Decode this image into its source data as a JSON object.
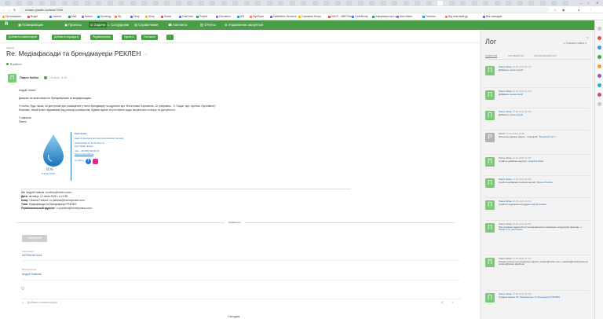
{
  "browser": {
    "url": "redam.planfix.ua/task/7339",
    "bookmarks": [
      "Пропонувати",
      "Вхідні",
      "Journal",
      "Mail",
      "Notion",
      "Synology",
      "My",
      "Ebay",
      "Shop",
      "Social",
      "OneDrive",
      "Project",
      "Education",
      "API",
      "MyoRyan",
      "Hafttelefon Services",
      "Отримати бонус",
      "НАСС - МВП Slant",
      "CodeRenty",
      "Інформація про хар",
      "Alan Wake",
      "Головна",
      "Від платників ду",
      "Все закладки"
    ],
    "controls": [
      "—",
      "□",
      "✕"
    ]
  },
  "appnav": {
    "brand": "R",
    "items": [
      {
        "label": "Планировщик",
        "active": false
      },
      {
        "label": "Проекты",
        "active": false
      },
      {
        "label": "Задачи",
        "active": true
      },
      {
        "label": "Сотрудники",
        "active": false
      },
      {
        "label": "Справочники",
        "active": false
      },
      {
        "label": "Контакты",
        "active": false
      },
      {
        "label": "Отчеты",
        "active": false
      },
      {
        "label": "Управление аккаунтом",
        "active": false
      }
    ]
  },
  "toolbar": {
    "buttons": [
      "Добавить комментарий",
      "Добавить подзадачу",
      "Редактировать",
      "Удалить",
      "Положить",
      "···"
    ]
  },
  "task": {
    "crumb": "Задача",
    "title": "Re: Медіафасади та брендмауери РЕКЛЕН",
    "star": "☆",
    "status": "В работе"
  },
  "message": {
    "author": "Павло Кабан",
    "time": "15 июня, 11:15",
    "avatar_letter": "П",
    "body": [
      "Андрій, вітаю!",
      "Дякуємо за пропозицію по брендмауерам та медіафасадам.",
      "Уточніть, будь ласка, чи доступний для розміщення у липні брендмауер за адресою вул. В'ячеслава Чорновола, 10 (напрямок - Л. Подол, вул. Артема, Лук'янівка)?",
      "Можливо, інший клієнт відмовився від резерву розміщення, будемо вдячні за уточнення щодо актуального статусу та доступності.",
      "З повагою,",
      "Павло"
    ],
    "signature": {
      "logo_text": "IDS",
      "logo_sub": "UKRAINE",
      "name": "Pavlo Koban",
      "role": "Head of advertising and new communication channels",
      "address": "Avtozavodska str. 13-15, floor 12",
      "city": "Kyiv, 03194, Ukraine",
      "phone": "mob.: +38 (098) 633-30-30",
      "site": "www.morshynska.ua",
      "social": "my water ♥"
    },
    "forward": [
      {
        "label": "От:",
        "value": "Андрій Новіков <novikov@reclen.com>"
      },
      {
        "label": "Дата:",
        "value": "пятница, 12 июня 2026 г. в 12:59"
      },
      {
        "label": "Кому:",
        "value": "Oksana Pankiva <o.pankiva@morshynska.com>"
      },
      {
        "label": "Тема:",
        "value": "Медіафасади та брендмауери РЕКЛЕН"
      },
      {
        "label": "Первоначальный адресат:",
        "value": "<o.pankiva@morshynska.com>"
      }
    ],
    "expand": "Развернуть"
  },
  "actions": {
    "reply": "Завершить"
  },
  "fields": {
    "assigner_label": "Контрагент",
    "assigner_value": "МОРШИНСЬКА",
    "executor_label": "Исполнитель",
    "executor_value": "Андрій Новіков"
  },
  "comment": {
    "placeholder": "Добавить комментарий"
  },
  "log": {
    "title": "Лог",
    "sort": "Сначала новые",
    "tabs": [
      {
        "label": "СОБЫТИЯ",
        "active": true
      },
      {
        "label": "АКТИВНОСТЬ",
        "active": false
      },
      {
        "label": "ТЕХНИЧЕСКИЙ ЛОГ",
        "active": false
      }
    ],
    "entries": [
      {
        "who": "Павло Кабан",
        "when": "15-06-2026 (11:15)",
        "text": "Добавлен",
        "link": "комментарий",
        "gray": false
      },
      {
        "who": "Павло Кабан",
        "when": "15-06-2026 (11:09)",
        "text": "Добавлен",
        "link": "комментарий",
        "gray": false
      },
      {
        "who": "Павло Кабан",
        "when": "15-06-2026 (11:08)",
        "text": "Добавлен",
        "link": "комментарий",
        "gray": false
      },
      {
        "who": "Planfix",
        "when": "15-06-2026 (11:08)",
        "text": "Изменены данные задачи · Сценарий:",
        "link": "\"Входящий лист\"",
        "gray": true
      },
      {
        "who": "Павло Кабан",
        "when": "15-06-2026 (11:08)",
        "text": "К работе добавлен аудитор:",
        "link": "Андрій Новіков",
        "gray": false
      },
      {
        "who": "Павло Кабан",
        "when": "15-06-2026 (11:08)",
        "text": "К работе добавлен участник контакт",
        "link": "Oksana Pankiva",
        "gray": false
      },
      {
        "who": "Павло Кабан",
        "when": "15-06-2026 (11:08)",
        "text": "К работе подключен сотрудник",
        "link": "Андрій Новіков",
        "gray": false
      },
      {
        "who": "Павло Кабан",
        "when": "15-06-2026 (11:08)",
        "text": "При создании задачи были последовательно применены следующие фильтры:",
        "link": "1. Правило по умолчанию",
        "gray": false
      },
      {
        "who": "Павло Кабан",
        "when": "15-06-2026 (11:08)",
        "text": "Письмо пришло на следующие адреса: novikov@reclen.com, o.pankiva@morshynska.ua, novikov@reclen.planfix.ua",
        "link": "",
        "gray": false
      },
      {
        "who": "Павло Кабан",
        "when": "15-06-2026 (11:08)",
        "text": "Создана задача",
        "link": "Re: Медіафасади та брендмауери РЕКЛЕН",
        "gray": false
      }
    ]
  },
  "bottom_peek": "Сегодня"
}
